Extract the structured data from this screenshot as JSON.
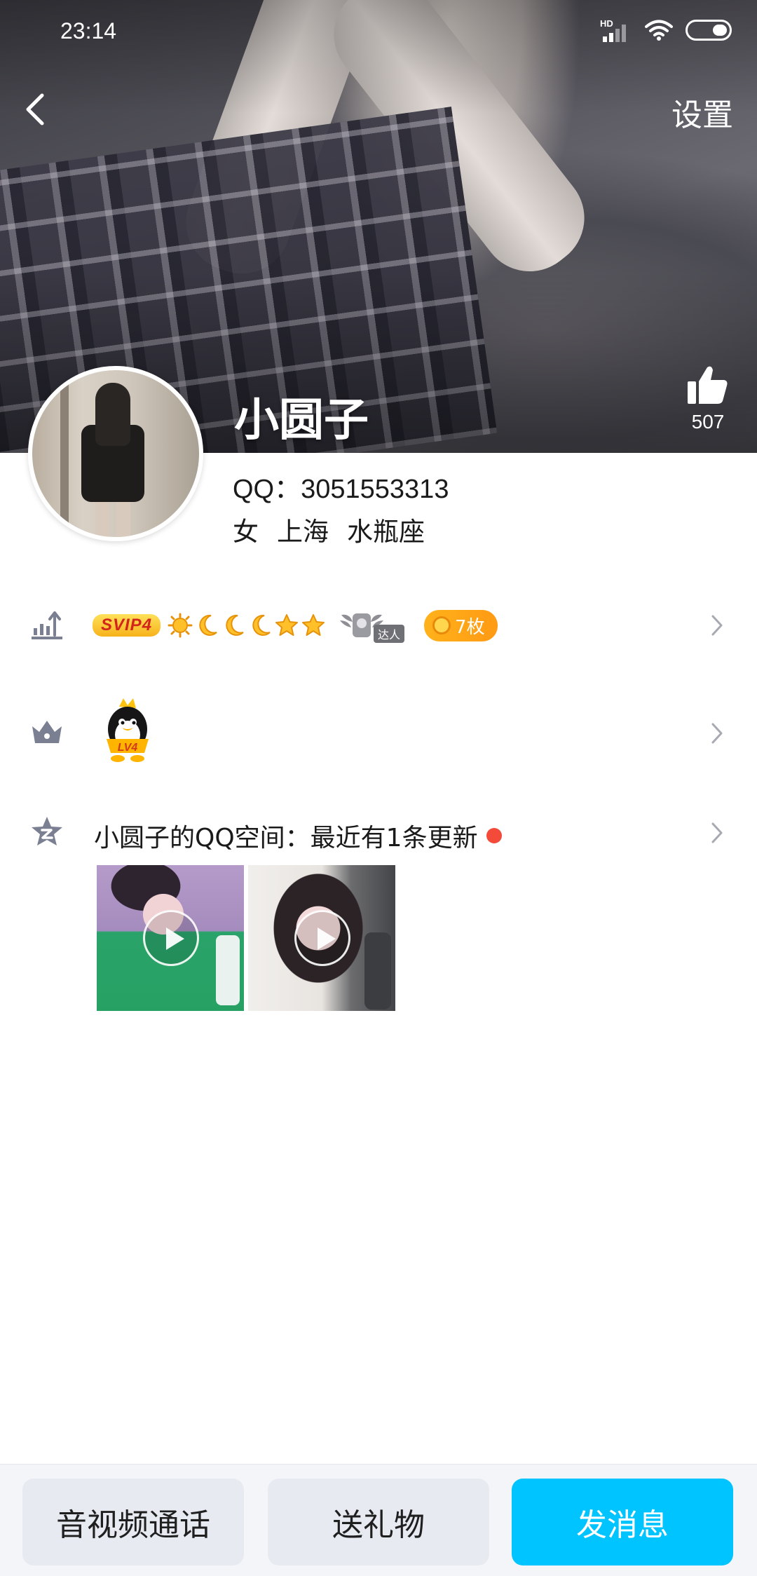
{
  "status_bar": {
    "time": "23:14",
    "network_label": "HD"
  },
  "nav": {
    "settings_label": "设置"
  },
  "profile": {
    "nickname": "小圆子",
    "likes": "507",
    "qq": "QQ：3051553313",
    "tags": [
      "女",
      "上海",
      "水瓶座"
    ]
  },
  "level_row": {
    "svip_label": "SVIP4",
    "level_icons": [
      "sun-icon",
      "moon-icon",
      "moon-icon",
      "moon-icon",
      "star-icon",
      "star-icon"
    ],
    "talent_label": "达人",
    "medal_label": "7枚"
  },
  "vip_row": {
    "badge_label": "LV4"
  },
  "qzone": {
    "title": "小圆子的QQ空间：最近有1条更新",
    "thumbnails": [
      "video-1",
      "video-2"
    ]
  },
  "bottom": {
    "call_label": "音视频通话",
    "gift_label": "送礼物",
    "message_label": "发消息"
  },
  "colors": {
    "accent": "#00c4ff",
    "medal": "#ff9a14",
    "update_dot": "#f44a3a",
    "svip_text": "#d2261b"
  }
}
